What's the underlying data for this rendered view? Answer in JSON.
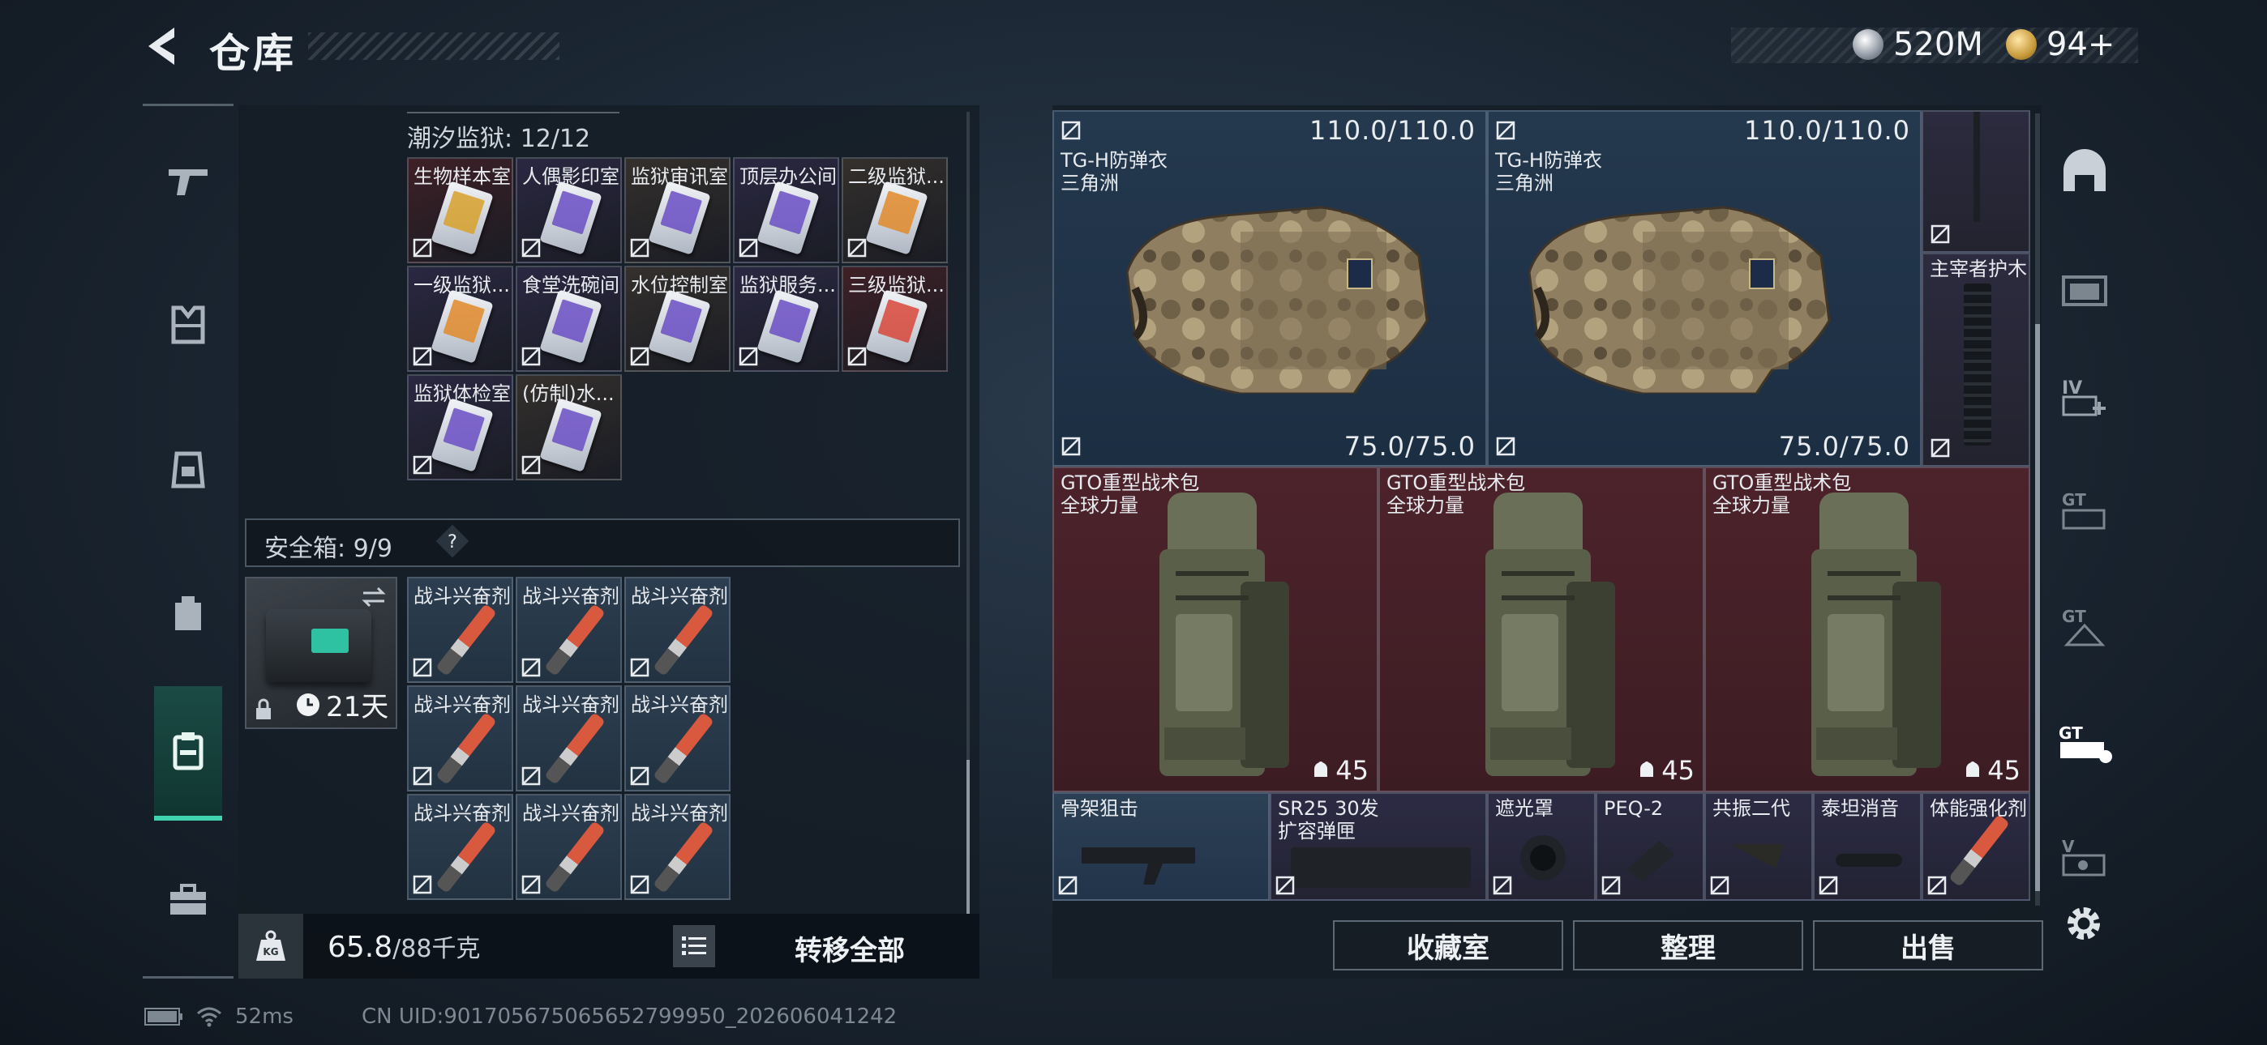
{
  "header": {
    "title": "仓库",
    "currency_money": "520M",
    "currency_tokens": "94+"
  },
  "left_nav": {
    "items": [
      "gun-icon",
      "armor-icon",
      "chest-rig-icon",
      "backpack-icon",
      "safebox-icon",
      "toolbox-icon"
    ]
  },
  "keycard_section": {
    "label": "潮汐监狱: 12/12",
    "cells": [
      {
        "label": "生物样本室",
        "color": "#3e2026",
        "accent": "gold"
      },
      {
        "label": "人偶影印室",
        "color": "#2a2842",
        "accent": "purple"
      },
      {
        "label": "监狱审讯室",
        "color": "#34302c",
        "accent": "purple"
      },
      {
        "label": "顶层办公间",
        "color": "#2a2842",
        "accent": "purple"
      },
      {
        "label": "二级监狱...",
        "color": "#34302c",
        "accent": "orange"
      },
      {
        "label": "一级监狱...",
        "color": "#2a2842",
        "accent": "orange"
      },
      {
        "label": "食堂洗碗间",
        "color": "#2a2842",
        "accent": "purple"
      },
      {
        "label": "水位控制室",
        "color": "#34302c",
        "accent": "purple"
      },
      {
        "label": "监狱服务...",
        "color": "#2a2842",
        "accent": "purple"
      },
      {
        "label": "三级监狱...",
        "color": "#3e2026",
        "accent": "red"
      },
      {
        "label": "监狱体检室",
        "color": "#2a2842",
        "accent": "purple"
      },
      {
        "label": "(仿制)水...",
        "color": "#34302c",
        "accent": "purple"
      }
    ]
  },
  "safebox": {
    "label": "安全箱: 9/9",
    "help": "?",
    "days": "21天",
    "items": [
      "战斗兴奋剂",
      "战斗兴奋剂",
      "战斗兴奋剂",
      "战斗兴奋剂",
      "战斗兴奋剂",
      "战斗兴奋剂",
      "战斗兴奋剂",
      "战斗兴奋剂",
      "战斗兴奋剂"
    ]
  },
  "bottom_left": {
    "weight": "65.8",
    "weight_max": "/88千克",
    "transfer_label": "转移全部"
  },
  "storage": {
    "armor": [
      {
        "name": "TG-H防弹衣",
        "sub": "三角洲",
        "durability_top": "110.0/110.0",
        "durability_bottom": "75.0/75.0"
      },
      {
        "name": "TG-H防弹衣",
        "sub": "三角洲",
        "durability_top": "110.0/110.0",
        "durability_bottom": "75.0/75.0"
      }
    ],
    "side_item": "主宰者护木",
    "bags": [
      {
        "name": "GTO重型战术包",
        "sub": "全球力量",
        "weight": "45"
      },
      {
        "name": "GTO重型战术包",
        "sub": "全球力量",
        "weight": "45"
      },
      {
        "name": "GTO重型战术包",
        "sub": "全球力量",
        "weight": "45"
      }
    ],
    "small_items": [
      {
        "label": "骨架狙击"
      },
      {
        "label": "SR25 30发",
        "sub": "扩容弹匣"
      },
      {
        "label": "遮光罩"
      },
      {
        "label": "PEQ-2"
      },
      {
        "label": "共振二代"
      },
      {
        "label": "泰坦消音"
      },
      {
        "label": "体能强化剂"
      }
    ]
  },
  "actions": {
    "collection": "收藏室",
    "sort": "整理",
    "sell": "出售"
  },
  "right_nav": {
    "items": [
      "helmet-icon",
      "page-1-icon",
      "page-4-icon",
      "page-gt1-icon",
      "page-gt2-icon",
      "page-gt3-icon",
      "page-5-icon"
    ],
    "labels": [
      "",
      "",
      "IV",
      "GT",
      "GT",
      "GT",
      "V"
    ]
  },
  "status_bar": {
    "ping": "52ms",
    "uid": "CN UID:901705675065652799950_202606041242"
  },
  "colors": {
    "accent": "#3fd3b0",
    "bag_bg": "#4a2229",
    "armor_bg": "#23374d"
  }
}
